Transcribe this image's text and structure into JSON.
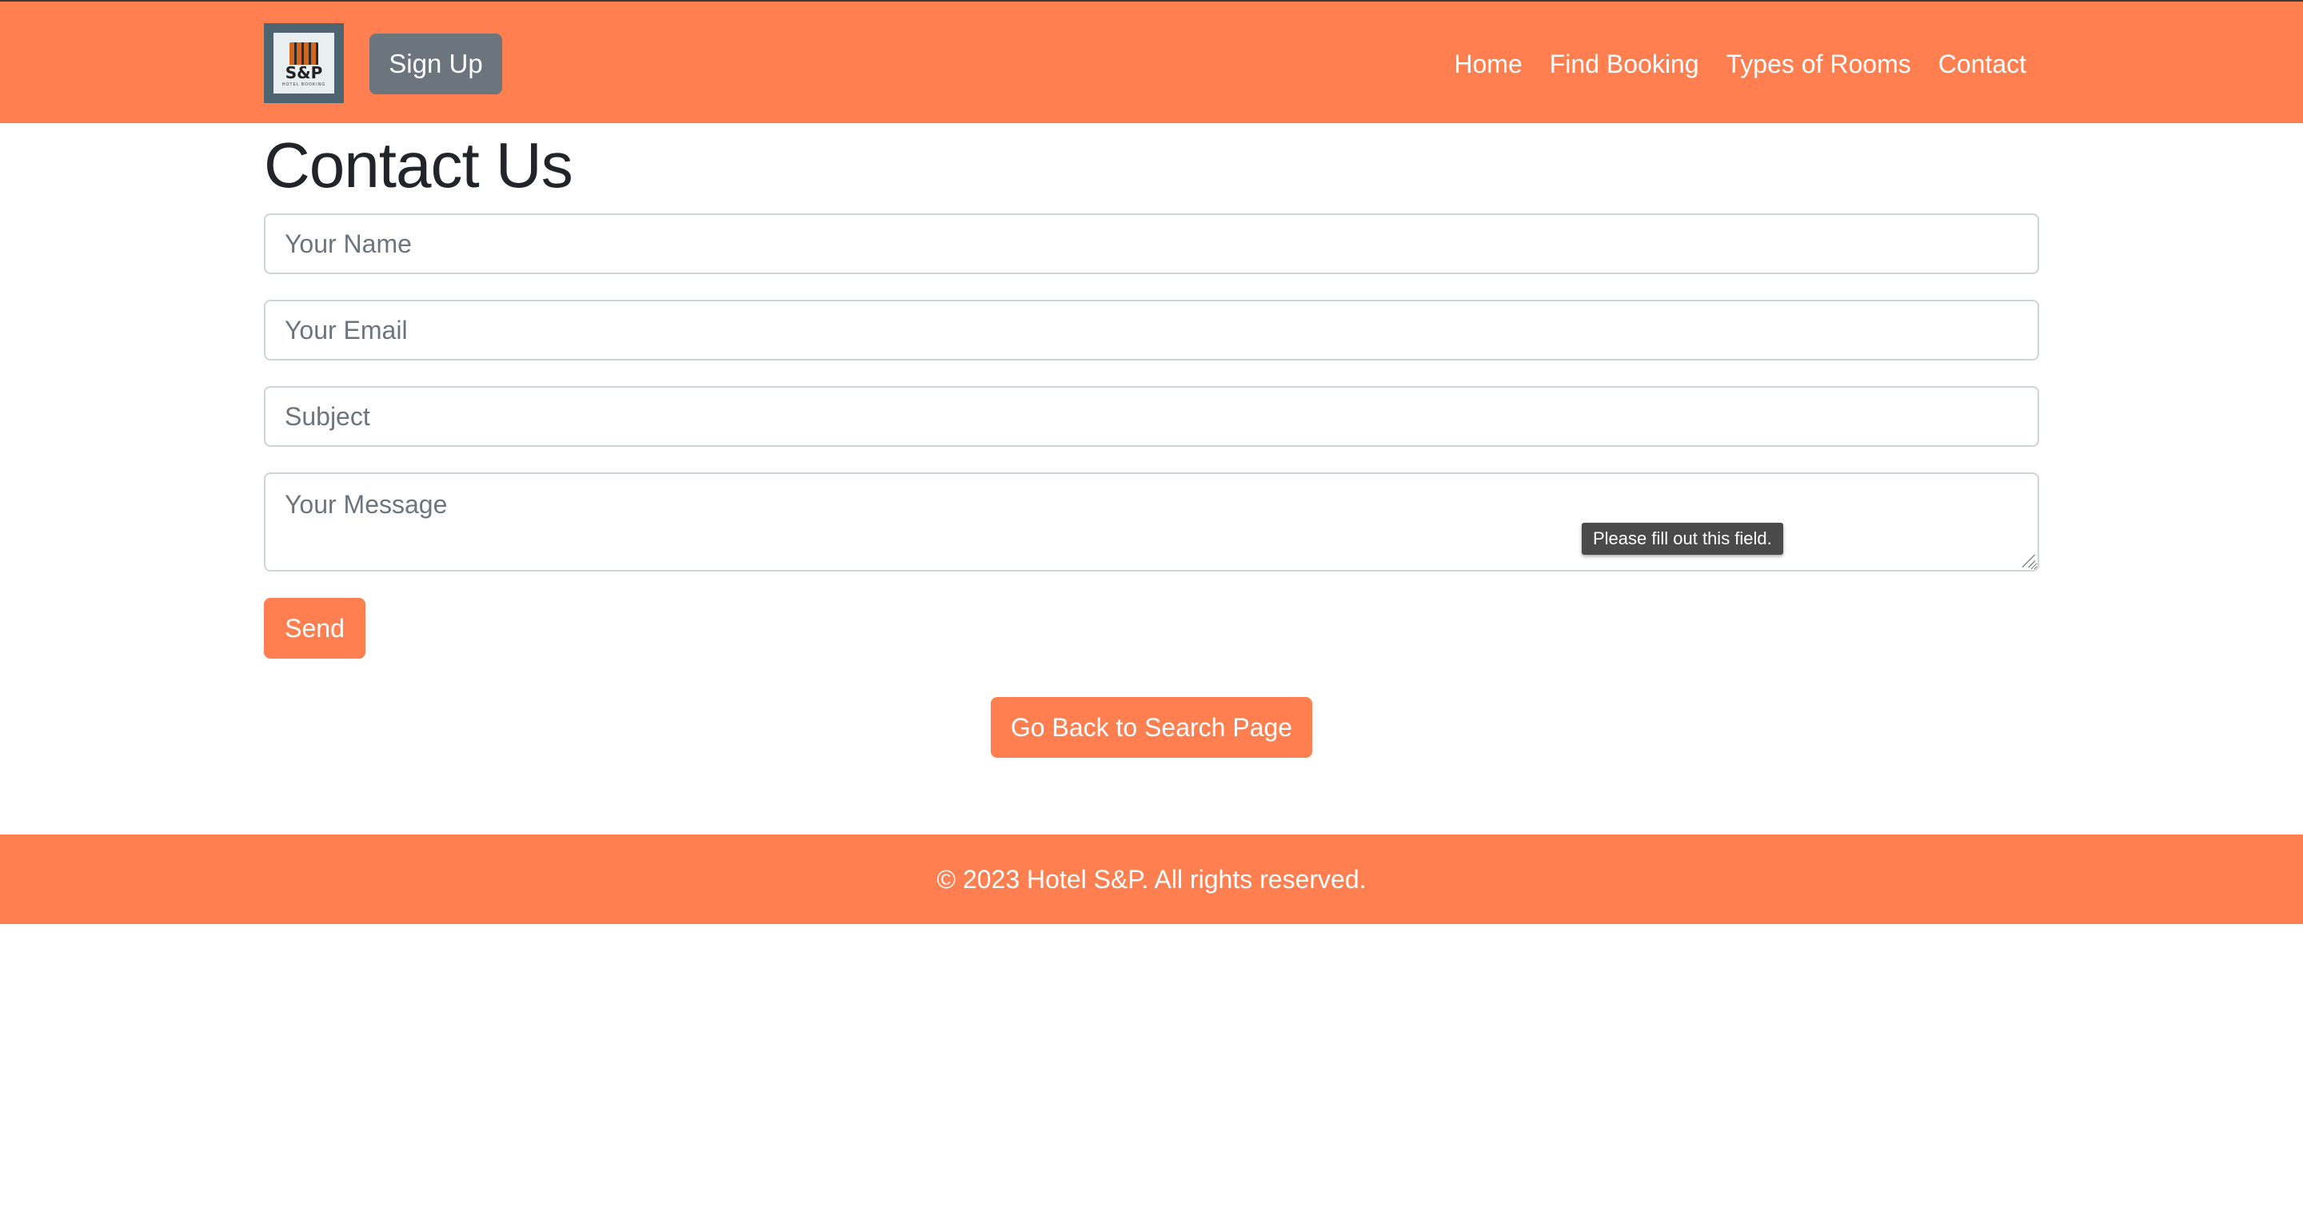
{
  "brand": {
    "logo_text": "S&P",
    "logo_subtext": "HOTEL BOOKING"
  },
  "header": {
    "signup_label": "Sign Up",
    "nav": [
      {
        "label": "Home"
      },
      {
        "label": "Find Booking"
      },
      {
        "label": "Types of Rooms"
      },
      {
        "label": "Contact"
      }
    ]
  },
  "main": {
    "title": "Contact Us",
    "form": {
      "name_placeholder": "Your Name",
      "email_placeholder": "Your Email",
      "subject_placeholder": "Subject",
      "message_placeholder": "Your Message",
      "validation_tooltip": "Please fill out this field.",
      "send_label": "Send"
    },
    "back_label": "Go Back to Search Page"
  },
  "footer": {
    "text": "© 2023 Hotel S&P. All rights reserved."
  },
  "colors": {
    "accent": "#ff7f50",
    "signup_button": "#6c757d",
    "title_text": "#212529",
    "tooltip_bg": "#4a4a4a"
  },
  "icons": {
    "logo": "hotel-building-logo-icon",
    "resize": "textarea-resize-grip-icon"
  }
}
